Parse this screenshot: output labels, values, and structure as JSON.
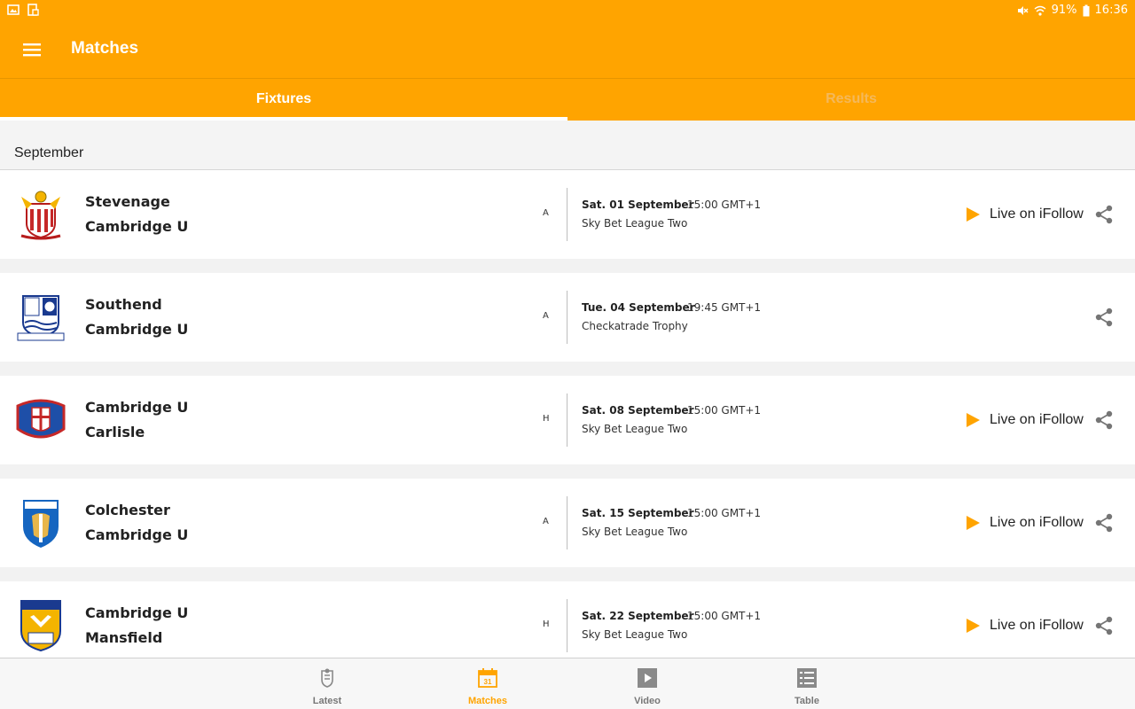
{
  "status_bar": {
    "battery": "91%",
    "time": "16:36",
    "icons": [
      "gallery-icon",
      "screenshot-icon",
      "mute-icon",
      "wifi-icon",
      "battery-icon"
    ]
  },
  "app_bar": {
    "title": "Matches",
    "menu_icon": "hamburger-menu-icon"
  },
  "tabs": [
    {
      "label": "Fixtures",
      "selected": true
    },
    {
      "label": "Results",
      "selected": false
    }
  ],
  "month": "September",
  "fixtures": [
    {
      "home": "Stevenage",
      "away": "Cambridge U",
      "venue": "A",
      "date": "Sat. 01 September",
      "time": "15:00 GMT+1",
      "competition": "Sky Bet League Two",
      "live": "Live on iFollow",
      "crest": "stevenage-crest-icon"
    },
    {
      "home": "Southend",
      "away": "Cambridge U",
      "venue": "A",
      "date": "Tue. 04 September",
      "time": "19:45 GMT+1",
      "competition": "Checkatrade Trophy",
      "live": "",
      "crest": "southend-crest-icon"
    },
    {
      "home": "Cambridge U",
      "away": "Carlisle",
      "venue": "H",
      "date": "Sat. 08 September",
      "time": "15:00 GMT+1",
      "competition": "Sky Bet League Two",
      "live": "Live on iFollow",
      "crest": "carlisle-crest-icon"
    },
    {
      "home": "Colchester",
      "away": "Cambridge U",
      "venue": "A",
      "date": "Sat. 15 September",
      "time": "15:00 GMT+1",
      "competition": "Sky Bet League Two",
      "live": "Live on iFollow",
      "crest": "colchester-crest-icon"
    },
    {
      "home": "Cambridge U",
      "away": "Mansfield",
      "venue": "H",
      "date": "Sat. 22 September",
      "time": "15:00 GMT+1",
      "competition": "Sky Bet League Two",
      "live": "Live on iFollow",
      "crest": "mansfield-crest-icon"
    }
  ],
  "bottom_nav": [
    {
      "label": "Latest",
      "icon": "crest-icon",
      "active": false
    },
    {
      "label": "Matches",
      "icon": "calendar-icon",
      "calendar_day": "31",
      "active": true
    },
    {
      "label": "Video",
      "icon": "play-icon",
      "active": false
    },
    {
      "label": "Table",
      "icon": "table-list-icon",
      "active": false
    }
  ],
  "colors": {
    "accent": "#ffa400",
    "tab_inactive": "#f4b85a",
    "text": "#222222"
  }
}
